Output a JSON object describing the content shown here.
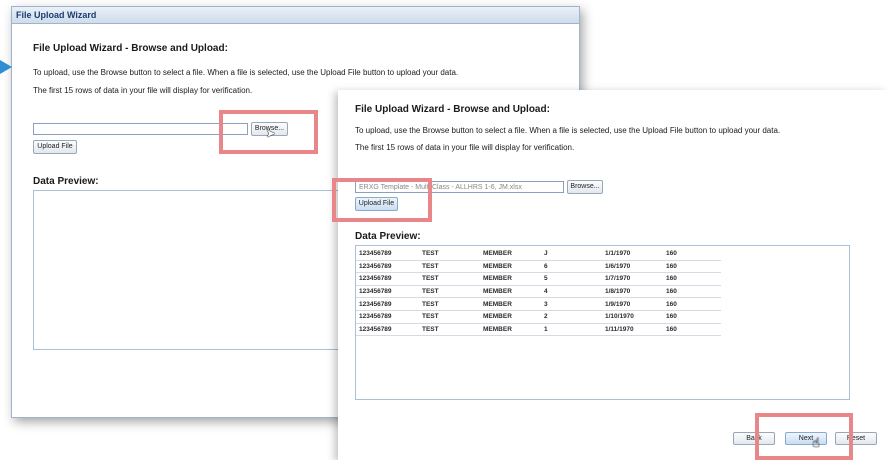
{
  "back_window": {
    "title": "File Upload Wizard",
    "heading": "File Upload Wizard - Browse and Upload:",
    "instructions": "To upload, use the Browse button to select a file. When a file is selected, use the Upload File button to upload your data.",
    "note": "The first 15 rows of data in your file will display for verification.",
    "file_value": "",
    "browse_label": "Browse...",
    "upload_label": "Upload File",
    "preview_label": "Data Preview:"
  },
  "front_window": {
    "heading": "File Upload Wizard - Browse and Upload:",
    "instructions": "To upload, use the Browse button to select a file. When a file is selected, use the Upload File button to upload your data.",
    "note": "The first 15 rows of data in your file will display for verification.",
    "file_value": "ERXG Template - Multi Class - ALLHRS 1-6, JM.xlsx",
    "browse_label": "Browse...",
    "upload_label": "Upload File",
    "preview_label": "Data Preview:",
    "rows": [
      [
        "123456789",
        "TEST",
        "MEMBER",
        "J",
        "1/1/1970",
        "160"
      ],
      [
        "123456789",
        "TEST",
        "MEMBER",
        "6",
        "1/6/1970",
        "160"
      ],
      [
        "123456789",
        "TEST",
        "MEMBER",
        "5",
        "1/7/1970",
        "160"
      ],
      [
        "123456789",
        "TEST",
        "MEMBER",
        "4",
        "1/8/1970",
        "160"
      ],
      [
        "123456789",
        "TEST",
        "MEMBER",
        "3",
        "1/9/1970",
        "160"
      ],
      [
        "123456789",
        "TEST",
        "MEMBER",
        "2",
        "1/10/1970",
        "160"
      ],
      [
        "123456789",
        "TEST",
        "MEMBER",
        "1",
        "1/11/1970",
        "160"
      ]
    ],
    "back_label": "Back",
    "next_label": "Next",
    "reset_label": "Reset"
  },
  "colors": {
    "highlight": "#e8868a",
    "accent_arrow": "#2e8ed0",
    "title_text": "#1b3e6f"
  },
  "icons": {
    "cursor_arrow": "mouse-pointer-icon",
    "cursor_hand": "hand-pointer-icon"
  }
}
